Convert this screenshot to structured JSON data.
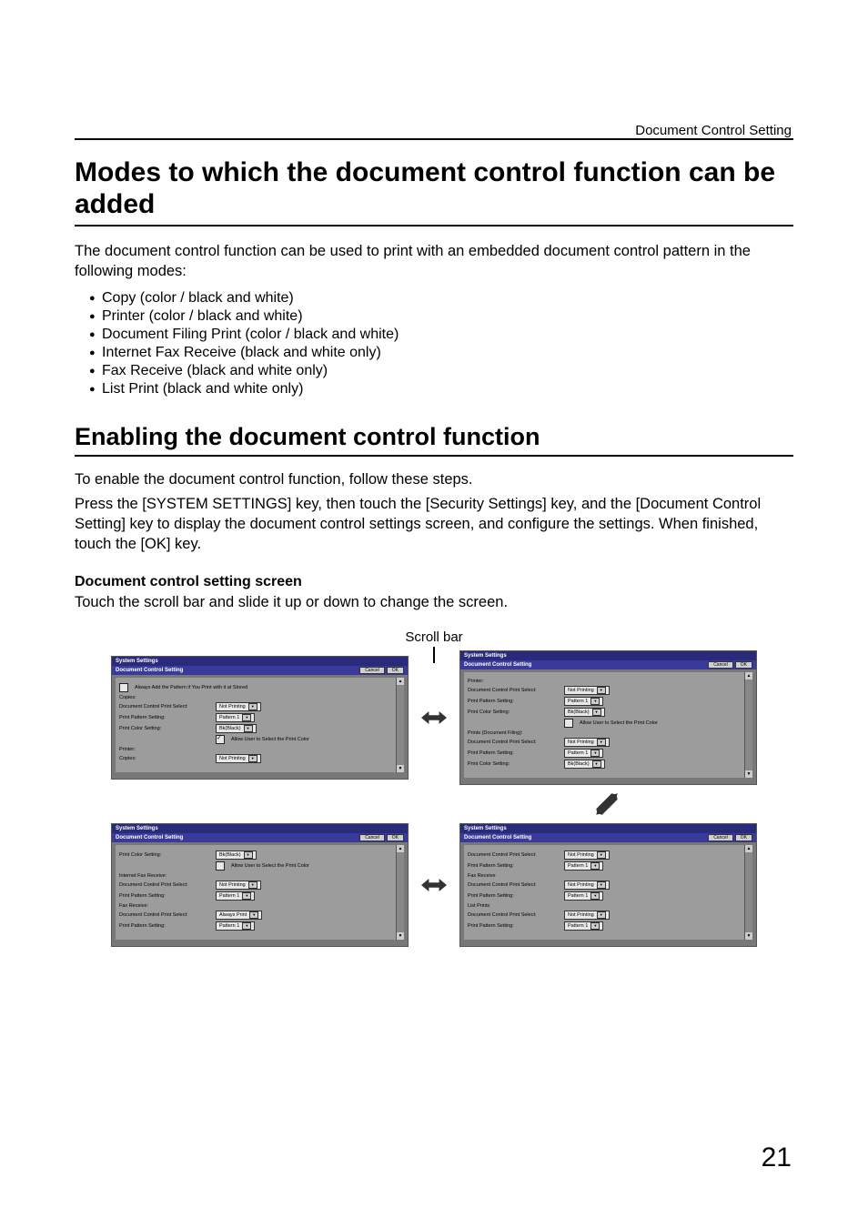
{
  "header_right": "Document Control Setting",
  "h1": "Modes to which the document control function can be added",
  "para1": "The document control function can be used to print with an embedded document control pattern in the following modes:",
  "modes": [
    "Copy (color / black and white)",
    "Printer (color / black and white)",
    "Document Filing Print (color / black and white)",
    "Internet Fax Receive (black and white only)",
    "Fax Receive (black and white only)",
    "List Print (black and white only)"
  ],
  "h2": "Enabling the document control function",
  "para2a": "To enable the document control function, follow these steps.",
  "para2b": "Press the [SYSTEM SETTINGS] key, then touch the [Security Settings] key, and the [Document Control Setting] key to display the document control settings screen, and configure the settings. When finished, touch the [OK] key.",
  "subhead": "Document control setting screen",
  "para3": "Touch the scroll bar and slide it up or down to change the screen.",
  "scroll_caption": "Scroll bar",
  "page_num": "21",
  "common": {
    "title": "System Settings",
    "subtitle": "Document Control Setting",
    "cancel": "Cancel",
    "ok": "OK",
    "dcps": "Document Control Print Select:",
    "pps": "Print Pattern Setting:",
    "pcs": "Print Color Setting:",
    "notprinting": "Not Printing",
    "alwaysprint": "Always Print",
    "pattern1": "Pattern 1",
    "bkblack": "Bk(Black)",
    "allow": "Allow User to Select the Print Color"
  },
  "shot1": {
    "always_add": "Always Add the Pattern if You Print with it at Stored",
    "copies": "Copies:",
    "printer": "Printer:"
  },
  "shot2": {
    "printer": "Printer:",
    "docfiling": "Prints (Document Filing):"
  },
  "shot3": {
    "ifax": "Internet Fax Receive:",
    "fax": "Fax Receive:"
  },
  "shot4": {
    "fax": "Fax Receive",
    "list": "List Prints"
  }
}
